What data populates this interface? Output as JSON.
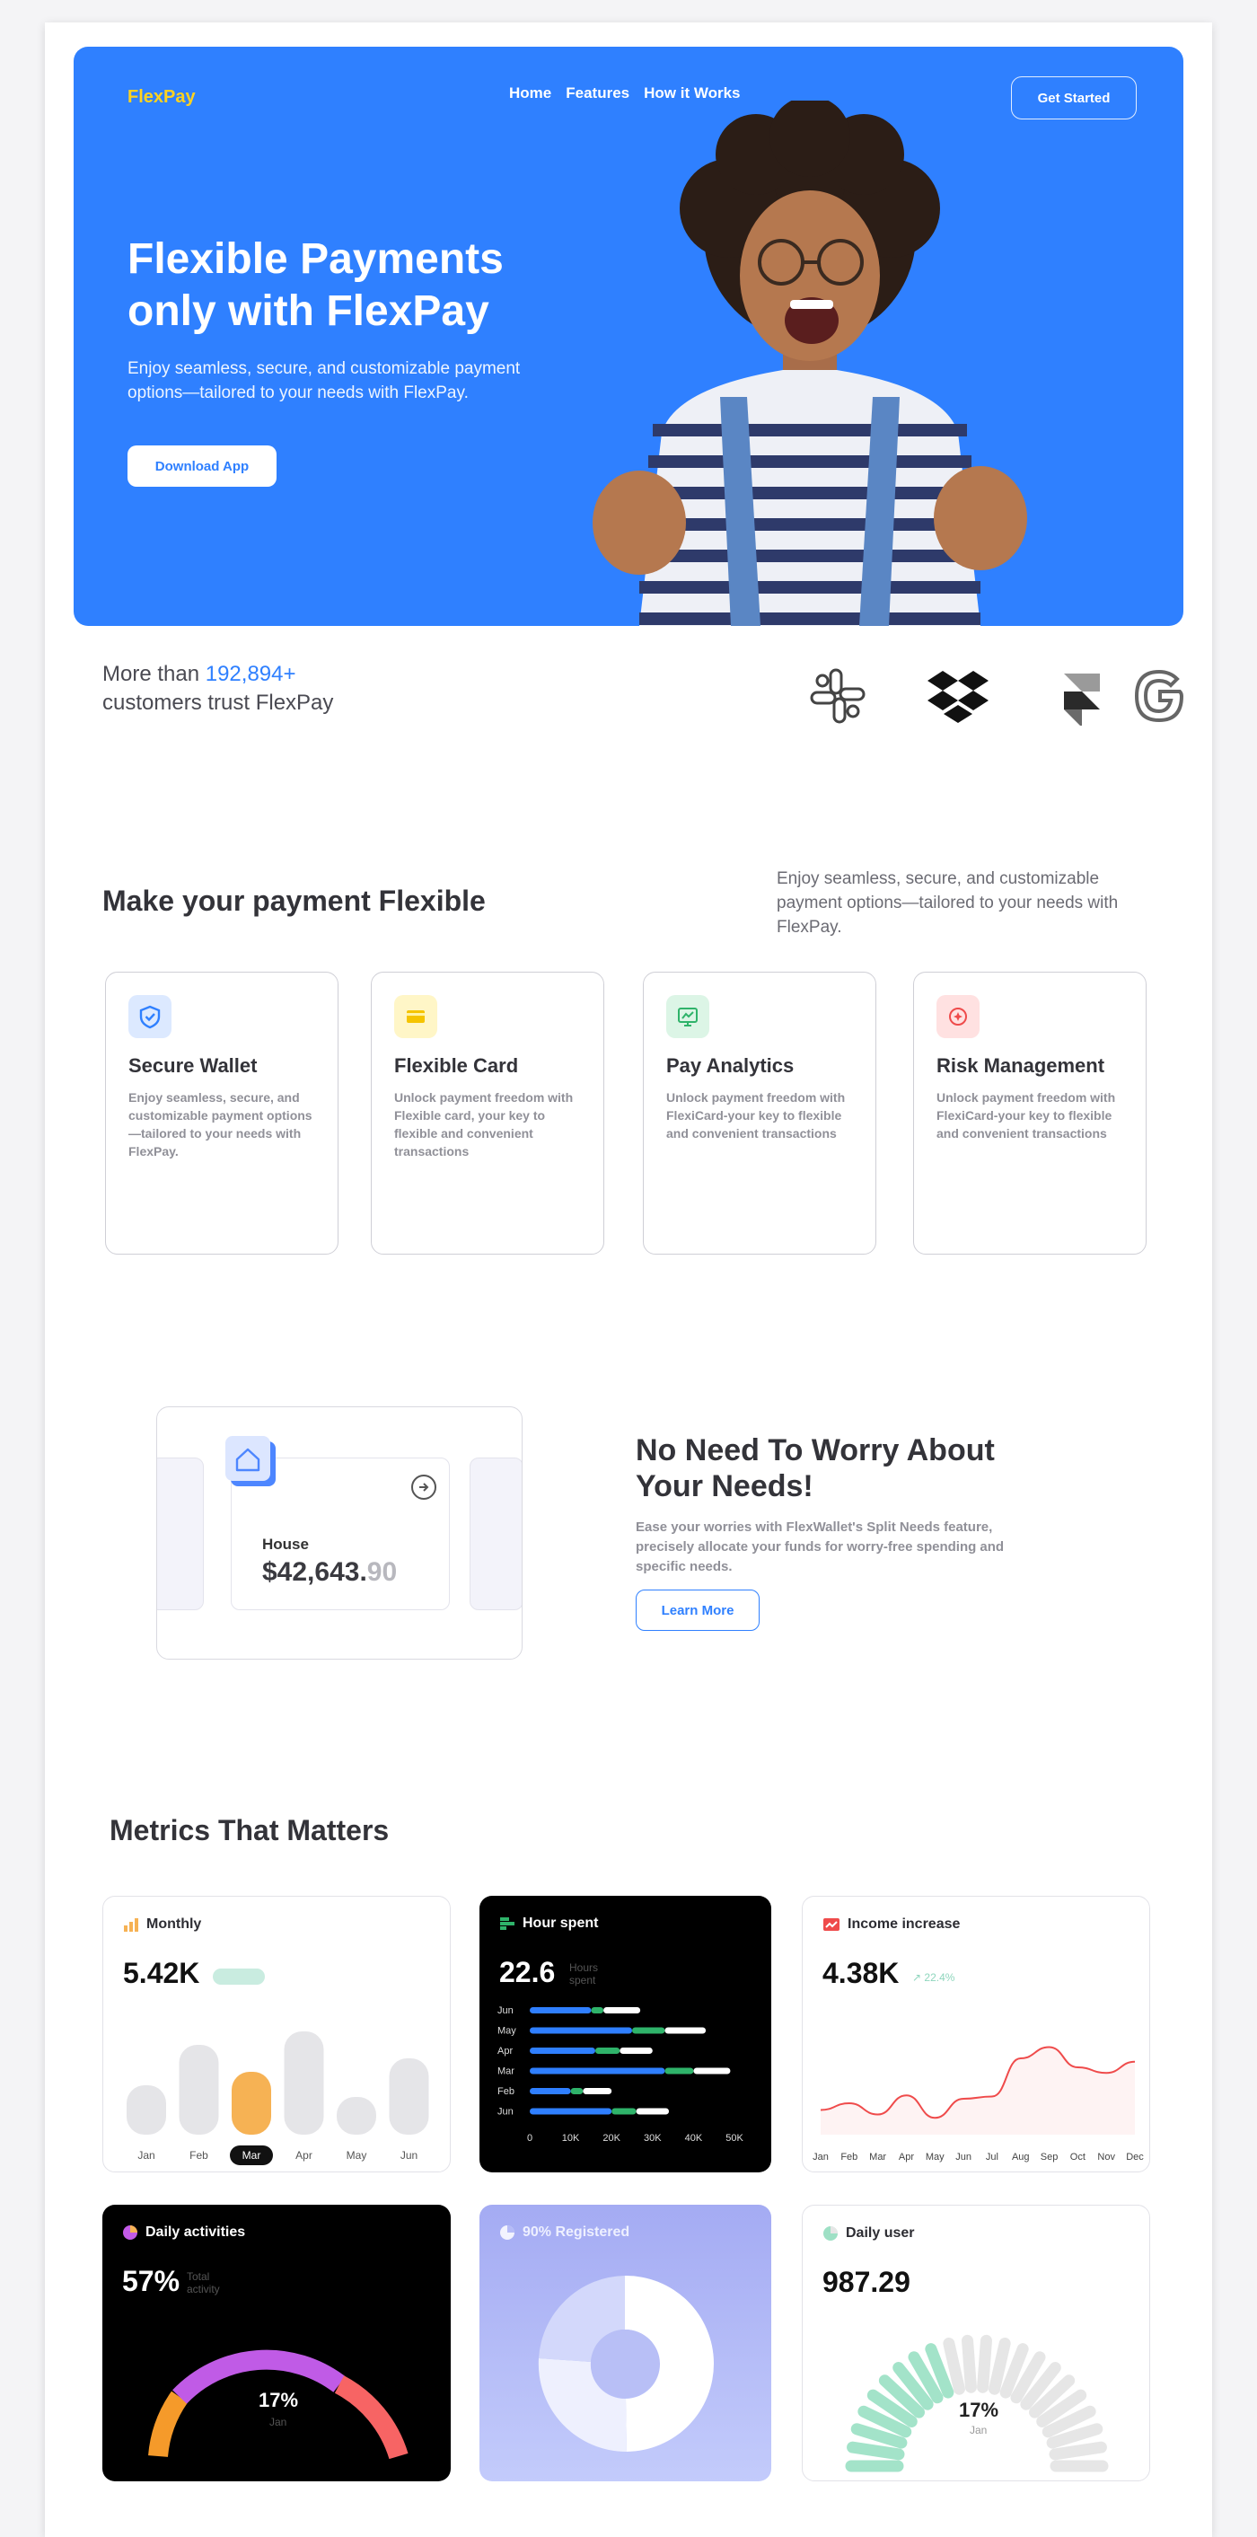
{
  "brand": {
    "logo": "FlexPay"
  },
  "nav": {
    "items": [
      "Home",
      "Features",
      "How it Works"
    ],
    "cta": "Get Started"
  },
  "hero": {
    "title_line1": "Flexible Payments",
    "title_line2": "only with FlexPay",
    "subtitle": "Enjoy seamless, secure, and customizable payment options—tailored to your needs with FlexPay.",
    "cta": "Download App"
  },
  "trust": {
    "prefix": "More than ",
    "count": "192,894+",
    "suffix": "customers trust FlexPay",
    "logos": [
      "slack-logo",
      "dropbox-logo",
      "framer-logo",
      "google-logo"
    ]
  },
  "features": {
    "title": "Make your payment Flexible",
    "description": "Enjoy seamless, secure, and customizable payment options—tailored to your needs with FlexPay.",
    "cards": [
      {
        "title": "Secure Wallet",
        "desc": "Enjoy seamless, secure, and customizable payment options—tailored to your needs with FlexPay.",
        "icon": "shield-icon",
        "color": "#2f80ff"
      },
      {
        "title": "Flexible Card",
        "desc": "Unlock payment freedom with Flexible card, your key to flexible and convenient transactions",
        "icon": "card-icon",
        "color": "#f5c400"
      },
      {
        "title": "Pay Analytics",
        "desc": "Unlock payment freedom with FlexiCard-your key to flexible and convenient transactions",
        "icon": "analytics-icon",
        "color": "#2fb36a"
      },
      {
        "title": "Risk Management",
        "desc": "Unlock payment freedom with FlexiCard-your key to flexible and convenient transactions",
        "icon": "risk-icon",
        "color": "#ef4b4b"
      }
    ]
  },
  "worry": {
    "card_label": "House",
    "card_amount_main": "$42,643.",
    "card_amount_dec": "90",
    "title": "No Need To Worry About Your Needs!",
    "description": "Ease your worries with FlexWallet's Split Needs feature, precisely allocate your funds for worry-free spending and specific needs.",
    "cta": "Learn More"
  },
  "metrics": {
    "title": "Metrics That Matters",
    "monthly": {
      "label": "Monthly",
      "value": "5.42K",
      "months": [
        "Jan",
        "Feb",
        "Mar",
        "Apr",
        "May",
        "Jun"
      ],
      "selected": "Mar"
    },
    "hours": {
      "label": "Hour spent",
      "value": "22.6",
      "unit": "Hours spent",
      "rows": [
        "Jun",
        "May",
        "Apr",
        "Mar",
        "Feb",
        "Jun"
      ],
      "ticks": [
        "0",
        "10K",
        "20K",
        "30K",
        "40K",
        "50K"
      ]
    },
    "income": {
      "label": "Income increase",
      "value": "4.38K",
      "change": "↗ 22.4%",
      "months": [
        "Jan",
        "Feb",
        "Mar",
        "Apr",
        "May",
        "Jun",
        "Jul",
        "Aug",
        "Sep",
        "Oct",
        "Nov",
        "Dec"
      ]
    },
    "daily_activities": {
      "label": "Daily activities",
      "value": "57%",
      "sub": "Total activity",
      "center": "17%",
      "center_sub": "Jan"
    },
    "registered": {
      "label": "90% Registered"
    },
    "daily_user": {
      "label": "Daily user",
      "value": "987.29",
      "center": "17%",
      "center_sub": "Jan"
    }
  },
  "chart_data": [
    {
      "type": "bar",
      "title": "Monthly",
      "categories": [
        "Jan",
        "Feb",
        "Mar",
        "Apr",
        "May",
        "Jun"
      ],
      "values": [
        55,
        100,
        70,
        115,
        42,
        85
      ],
      "selected": "Mar"
    },
    {
      "type": "bar",
      "orientation": "horizontal",
      "title": "Hour spent",
      "categories": [
        "Jun",
        "May",
        "Apr",
        "Mar",
        "Feb",
        "Jun"
      ],
      "xlim": [
        0,
        50000
      ],
      "series": [
        {
          "values": [
            15000,
            25000,
            16000,
            33000,
            10000,
            20000
          ]
        },
        {
          "values": [
            3000,
            8000,
            6000,
            7000,
            3000,
            6000
          ]
        },
        {
          "values": [
            9000,
            10000,
            8000,
            9000,
            7000,
            8000
          ]
        }
      ]
    },
    {
      "type": "line",
      "title": "Income increase",
      "categories": [
        "Jan",
        "Feb",
        "Mar",
        "Apr",
        "May",
        "Jun",
        "Jul",
        "Aug",
        "Sep",
        "Oct",
        "Nov",
        "Dec"
      ],
      "values": [
        22,
        28,
        18,
        35,
        15,
        32,
        34,
        68,
        78,
        60,
        55,
        65
      ]
    }
  ]
}
